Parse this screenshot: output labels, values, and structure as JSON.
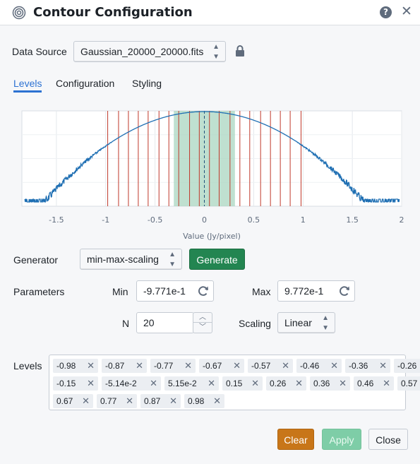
{
  "dialog": {
    "title": "Contour Configuration",
    "help_glyph": "?",
    "close_glyph": "✕"
  },
  "data_source": {
    "label": "Data Source",
    "value": "Gaussian_20000_20000.fits"
  },
  "tabs": [
    {
      "label": "Levels",
      "active": true
    },
    {
      "label": "Configuration",
      "active": false
    },
    {
      "label": "Styling",
      "active": false
    }
  ],
  "chart_data": {
    "type": "line",
    "title": "",
    "xlabel": "Value (Jy/pixel)",
    "ylabel": "",
    "xlim": [
      -1.85,
      2.0
    ],
    "x_ticks": [
      "-1.5",
      "-1",
      "-0.5",
      "0",
      "0.5",
      "1",
      "1.5",
      "2"
    ],
    "x_tick_values": [
      -1.5,
      -1,
      -0.5,
      0,
      0.5,
      1,
      1.5,
      2
    ],
    "log_y": true,
    "series": [
      {
        "type": "histogram-curve",
        "color": "#1f6fb3",
        "center": 0.0,
        "sigma": 0.5
      }
    ],
    "shaded_band": {
      "from": -0.31,
      "to": 0.31,
      "color": "#a9d6c0"
    },
    "center_line": {
      "x": 0.0,
      "style": "dashed"
    },
    "grid": true,
    "level_lines": [
      -0.98,
      -0.87,
      -0.77,
      -0.67,
      -0.57,
      -0.46,
      -0.36,
      -0.26,
      -0.15,
      -0.0514,
      0.0515,
      0.15,
      0.26,
      0.36,
      0.46,
      0.57,
      0.67,
      0.77,
      0.87,
      0.98
    ],
    "level_line_color": "#c0392b"
  },
  "generator": {
    "label": "Generator",
    "value": "min-max-scaling",
    "generate_label": "Generate"
  },
  "parameters": {
    "label": "Parameters",
    "min_label": "Min",
    "min_value": "-9.771e-1",
    "max_label": "Max",
    "max_value": "9.772e-1",
    "n_label": "N",
    "n_value": "20",
    "scaling_label": "Scaling",
    "scaling_value": "Linear"
  },
  "levels": {
    "label": "Levels",
    "tags": [
      "-0.98",
      "-0.87",
      "-0.77",
      "-0.67",
      "-0.57",
      "-0.46",
      "-0.36",
      "-0.26",
      "-0.15",
      "-5.14e-2",
      "5.15e-2",
      "0.15",
      "0.26",
      "0.36",
      "0.46",
      "0.57",
      "0.67",
      "0.77",
      "0.87",
      "0.98"
    ]
  },
  "footer": {
    "clear_label": "Clear",
    "apply_label": "Apply",
    "close_label": "Close"
  },
  "colors": {
    "accent": "#2d72d2",
    "generate": "#238551",
    "clear": "#c87619",
    "apply_disabled": "#7ecda7"
  }
}
